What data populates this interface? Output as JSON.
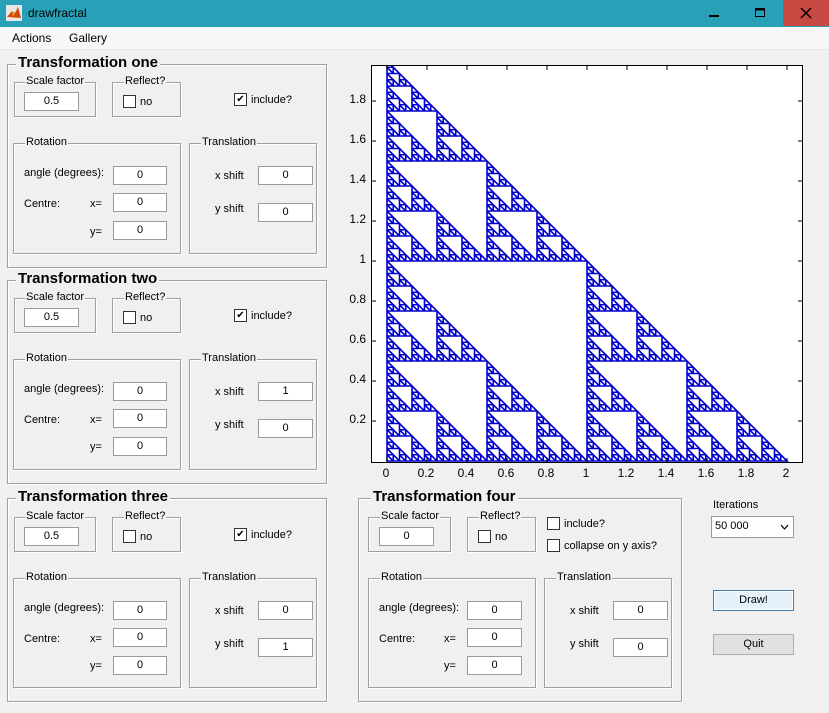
{
  "window": {
    "title": "drawfractal"
  },
  "menu": {
    "items": [
      "Actions",
      "Gallery"
    ]
  },
  "transformations": [
    {
      "title": "Transformation one",
      "scale_label": "Scale factor",
      "scale_value": "0.5",
      "reflect_label": "Reflect?",
      "reflect_option": "no",
      "reflect_checked": false,
      "include_label": "include?",
      "include_checked": true,
      "rotation_label": "Rotation",
      "angle_label": "angle (degrees):",
      "angle_value": "0",
      "centre_label": "Centre:",
      "cx_label": "x=",
      "cx_value": "0",
      "cy_label": "y=",
      "cy_value": "0",
      "translation_label": "Translation",
      "xshift_label": "x shift",
      "xshift_value": "0",
      "yshift_label": "y shift",
      "yshift_value": "0"
    },
    {
      "title": "Transformation two",
      "scale_label": "Scale factor",
      "scale_value": "0.5",
      "reflect_label": "Reflect?",
      "reflect_option": "no",
      "reflect_checked": false,
      "include_label": "include?",
      "include_checked": true,
      "rotation_label": "Rotation",
      "angle_label": "angle (degrees):",
      "angle_value": "0",
      "centre_label": "Centre:",
      "cx_label": "x=",
      "cx_value": "0",
      "cy_label": "y=",
      "cy_value": "0",
      "translation_label": "Translation",
      "xshift_label": "x shift",
      "xshift_value": "1",
      "yshift_label": "y shift",
      "yshift_value": "0"
    },
    {
      "title": "Transformation three",
      "scale_label": "Scale factor",
      "scale_value": "0.5",
      "reflect_label": "Reflect?",
      "reflect_option": "no",
      "reflect_checked": false,
      "include_label": "include?",
      "include_checked": true,
      "rotation_label": "Rotation",
      "angle_label": "angle (degrees):",
      "angle_value": "0",
      "centre_label": "Centre:",
      "cx_label": "x=",
      "cx_value": "0",
      "cy_label": "y=",
      "cy_value": "0",
      "translation_label": "Translation",
      "xshift_label": "x shift",
      "xshift_value": "0",
      "yshift_label": "y shift",
      "yshift_value": "1"
    },
    {
      "title": "Transformation four",
      "scale_label": "Scale factor",
      "scale_value": "0",
      "reflect_label": "Reflect?",
      "reflect_option": "no",
      "reflect_checked": false,
      "include_label": "include?",
      "include_checked": false,
      "collapse_label": "collapse on y axis?",
      "collapse_checked": false,
      "rotation_label": "Rotation",
      "angle_label": "angle (degrees):",
      "angle_value": "0",
      "centre_label": "Centre:",
      "cx_label": "x=",
      "cx_value": "0",
      "cy_label": "y=",
      "cy_value": "0",
      "translation_label": "Translation",
      "xshift_label": "x shift",
      "xshift_value": "0",
      "yshift_label": "y shift",
      "yshift_value": "0"
    }
  ],
  "controls": {
    "iterations_label": "Iterations",
    "iterations_value": "50 000",
    "draw_label": "Draw!",
    "quit_label": "Quit"
  },
  "plot": {
    "fractal": "Sierpinski triangle",
    "marker_color": "#0000cc",
    "x_ticks": [
      "0",
      "0.2",
      "0.4",
      "0.6",
      "0.8",
      "1",
      "1.2",
      "1.4",
      "1.6",
      "1.8",
      "2"
    ],
    "y_ticks": [
      "0.2",
      "0.4",
      "0.6",
      "0.8",
      "1",
      "1.2",
      "1.4",
      "1.6",
      "1.8"
    ],
    "xlim": [
      0,
      2
    ],
    "ylim": [
      0,
      2
    ],
    "vertices": [
      [
        0,
        0
      ],
      [
        2,
        0
      ],
      [
        0,
        2
      ]
    ]
  }
}
